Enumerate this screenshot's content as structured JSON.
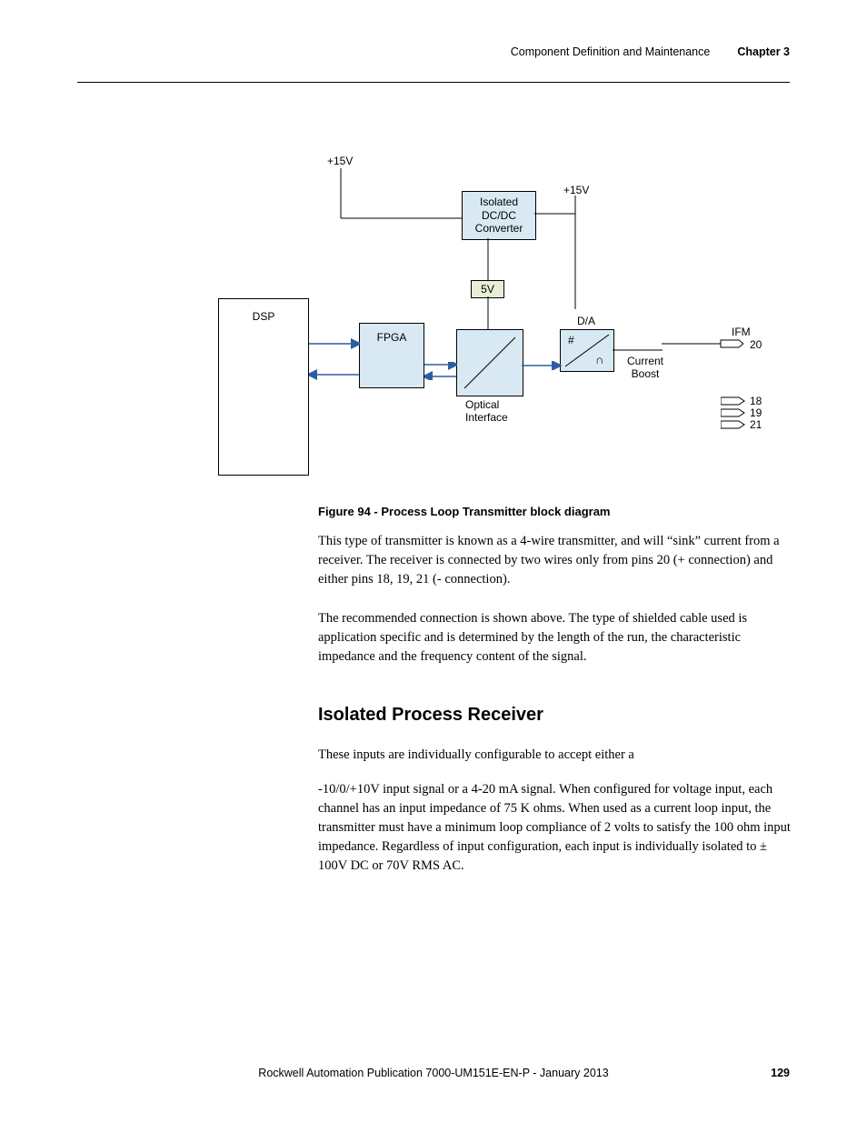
{
  "header": {
    "section": "Component Definition and Maintenance",
    "chapter": "Chapter 3"
  },
  "diagram": {
    "plus15v_left": "+15V",
    "plus15v_right": "+15V",
    "converter": "Isolated\nDC/DC\nConverter",
    "five_v": "5V",
    "dsp": "DSP",
    "fpga": "FPGA",
    "optical": "Optical\nInterface",
    "da": "D/A",
    "hash": "#",
    "cap": "∩",
    "current_boost": "Current\nBoost",
    "ifm": "IFM",
    "pin20": "20",
    "pin18": "18",
    "pin19": "19",
    "pin21": "21"
  },
  "caption": "Figure 94 - Process Loop Transmitter block diagram",
  "para1": "This type of transmitter is known as a 4-wire transmitter, and will “sink” current from a receiver. The receiver is connected by two wires only from pins 20 (+ connection) and either pins 18, 19, 21 (- connection).",
  "para2": "The recommended connection is shown above. The type of shielded cable used is application specific and is determined by the length of the run, the characteristic impedance and the frequency content of the signal.",
  "heading": "Isolated Process Receiver",
  "para3": "These inputs are individually configurable to accept either a",
  "para4": "-10/0/+10V input signal or a 4-20 mA signal. When configured for voltage input, each channel has an input impedance of 75 K ohms. When used as a current loop input, the transmitter must have a minimum loop compliance of 2 volts to satisfy the 100 ohm input impedance. Regardless of input configuration, each input is individually isolated to ± 100V DC or 70V RMS AC.",
  "footer": {
    "publication": "Rockwell Automation Publication 7000-UM151E-EN-P - January 2013",
    "page": "129"
  }
}
